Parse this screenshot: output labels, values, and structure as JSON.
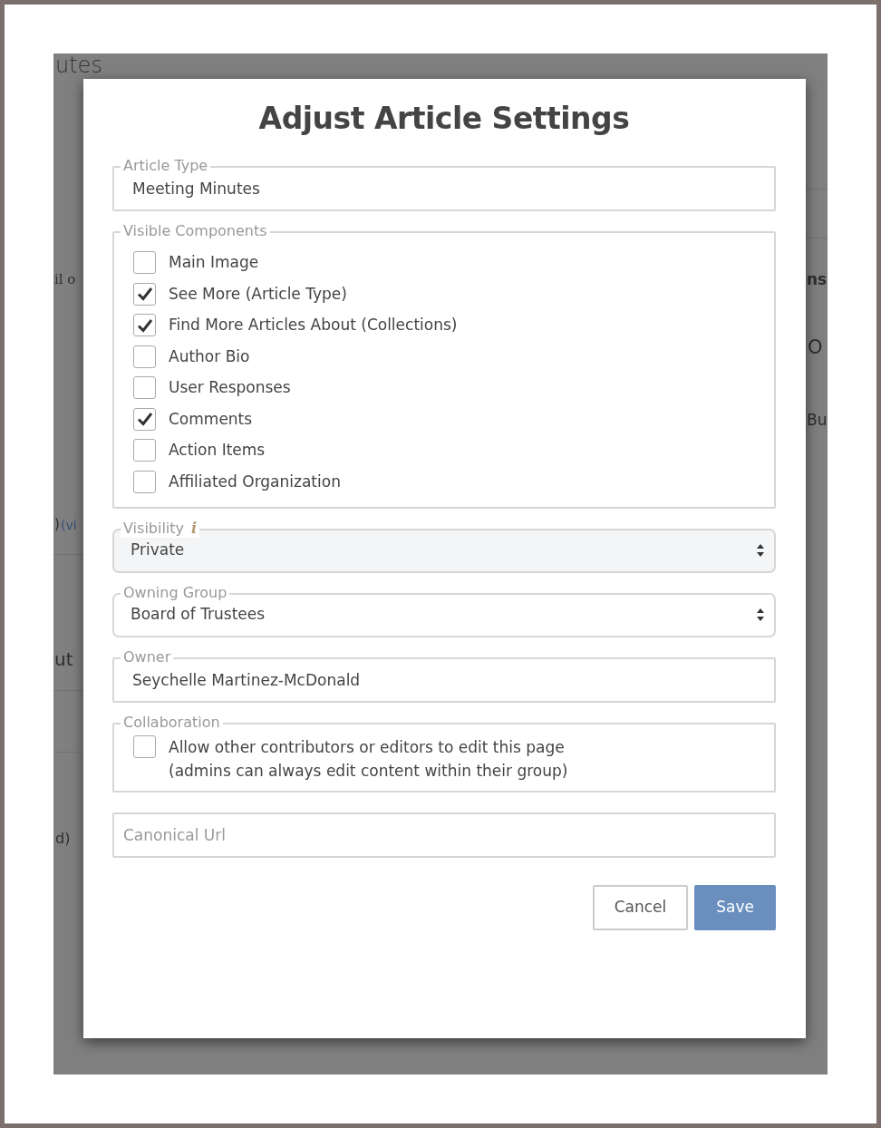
{
  "background": {
    "title": "utes",
    "fragments": [
      {
        "text": "il o",
        "kind": "text"
      },
      {
        "text": "ns",
        "kind": "bold"
      },
      {
        "text": "O",
        "kind": "text"
      },
      {
        "text": "Bu",
        "kind": "text"
      },
      {
        "text": ")",
        "kind": "text"
      },
      {
        "text": "(vi",
        "kind": "link"
      },
      {
        "text": "ut",
        "kind": "text"
      },
      {
        "text": "d)",
        "kind": "text"
      }
    ]
  },
  "dialog": {
    "title": "Adjust Article Settings",
    "article_type": {
      "label": "Article Type",
      "value": "Meeting Minutes"
    },
    "visible_components": {
      "label": "Visible Components",
      "items": [
        {
          "label": "Main Image",
          "checked": false
        },
        {
          "label": "See More (Article Type)",
          "checked": true
        },
        {
          "label": "Find More Articles About (Collections)",
          "checked": true
        },
        {
          "label": "Author Bio",
          "checked": false
        },
        {
          "label": "User Responses",
          "checked": false
        },
        {
          "label": "Comments",
          "checked": true
        },
        {
          "label": "Action Items",
          "checked": false
        },
        {
          "label": "Affiliated Organization",
          "checked": false
        }
      ]
    },
    "visibility": {
      "label": "Visibility",
      "info": "i",
      "value": "Private",
      "disabled": true
    },
    "owning_group": {
      "label": "Owning Group",
      "value": "Board of Trustees",
      "disabled": false
    },
    "owner": {
      "label": "Owner",
      "value": "Seychelle Martinez-McDonald"
    },
    "collaboration": {
      "label": "Collaboration",
      "checked": false,
      "lines": [
        "Allow other contributors or editors to edit this page",
        "(admins can always edit content within their group)"
      ]
    },
    "canonical_url": {
      "placeholder": "Canonical Url"
    },
    "buttons": [
      {
        "label": "Cancel",
        "kind": "secondary"
      },
      {
        "label": "Save",
        "kind": "primary"
      }
    ]
  }
}
